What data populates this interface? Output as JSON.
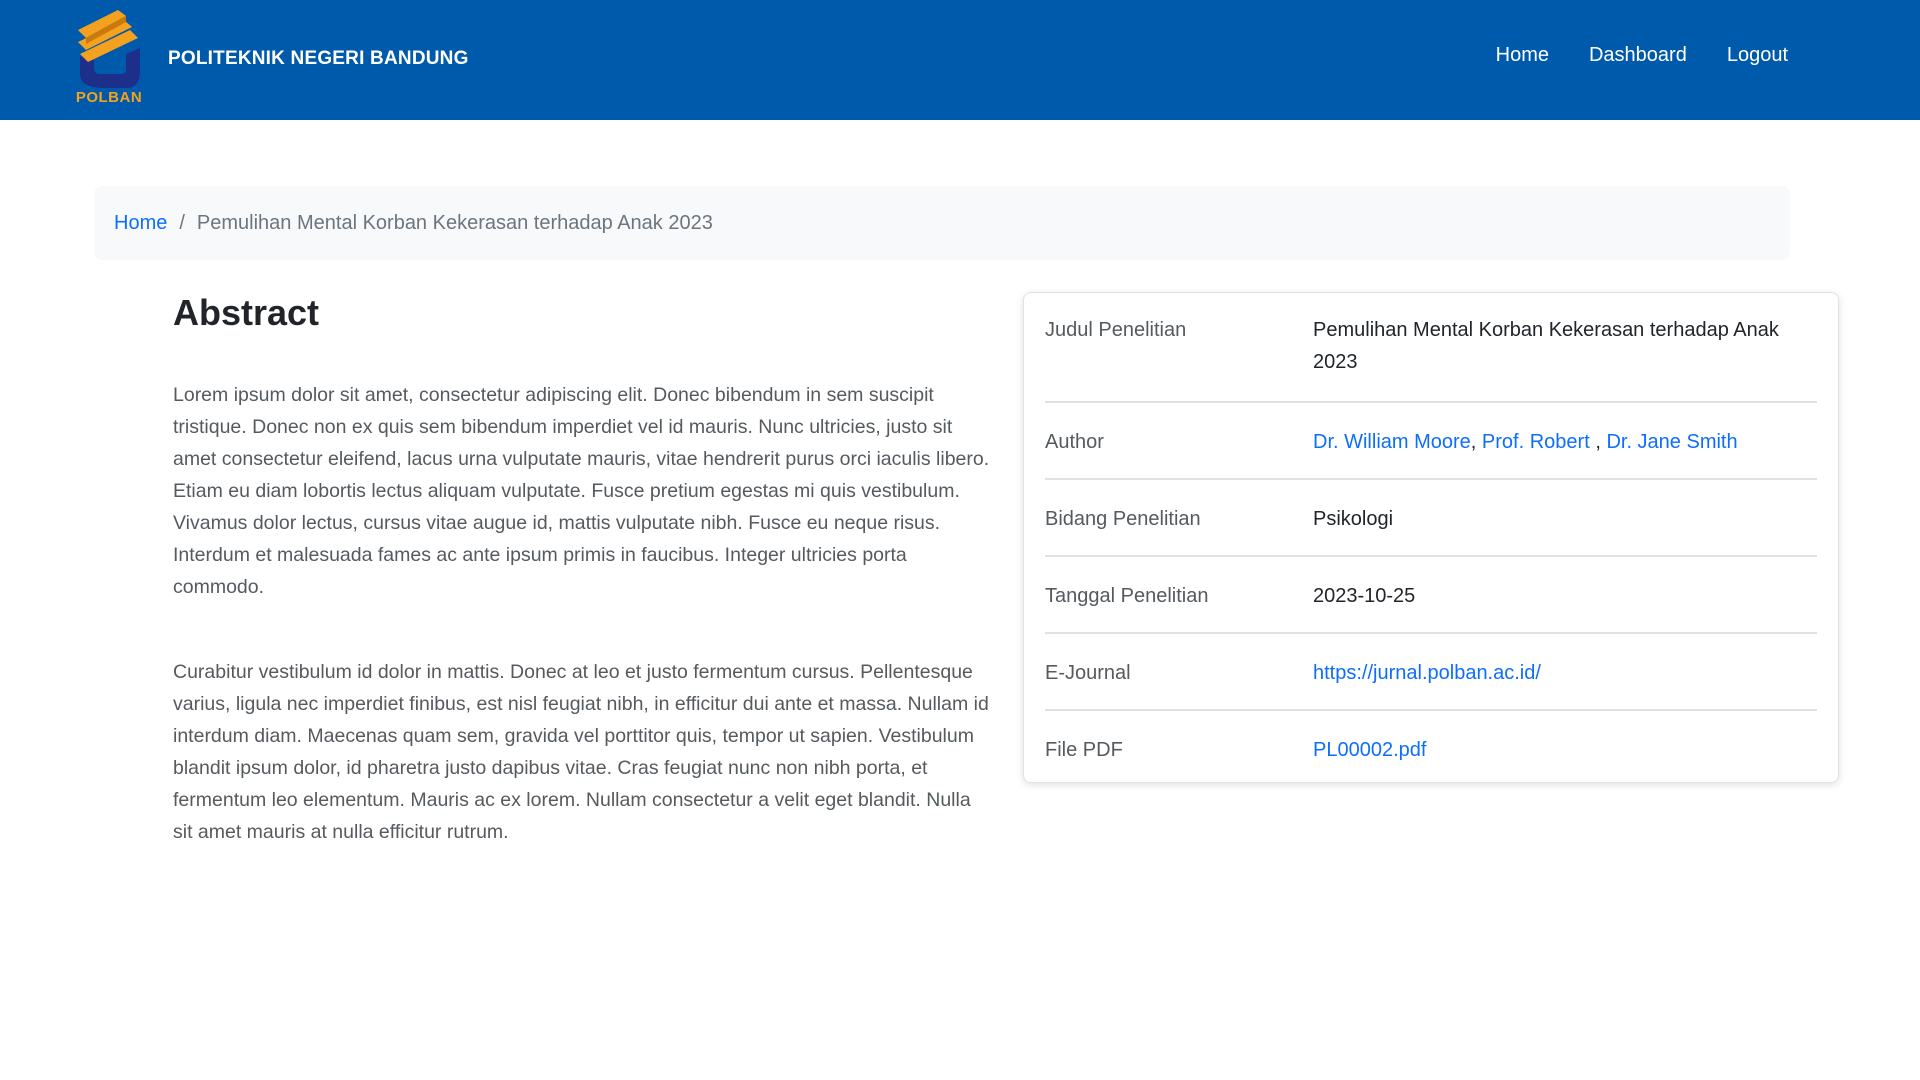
{
  "header": {
    "brand_name": "POLITEKNIK NEGERI BANDUNG",
    "logo_text": "POLBAN",
    "nav": [
      "Home",
      "Dashboard",
      "Logout"
    ]
  },
  "breadcrumb": {
    "home": "Home",
    "separator": "/",
    "current": "Pemulihan Mental Korban Kekerasan terhadap Anak 2023"
  },
  "abstract": {
    "heading": "Abstract",
    "paragraphs": [
      "Lorem ipsum dolor sit amet, consectetur adipiscing elit. Donec bibendum in sem suscipit tristique. Donec non ex quis sem bibendum imperdiet vel id mauris. Nunc ultricies, justo sit amet consectetur eleifend, lacus urna vulputate mauris, vitae hendrerit purus orci iaculis libero. Etiam eu diam lobortis lectus aliquam vulputate. Fusce pretium egestas mi quis vestibulum. Vivamus dolor lectus, cursus vitae augue id, mattis vulputate nibh. Fusce eu neque risus. Interdum et malesuada fames ac ante ipsum primis in faucibus. Integer ultricies porta commodo.",
      "Curabitur vestibulum id dolor in mattis. Donec at leo et justo fermentum cursus. Pellentesque varius, ligula nec imperdiet finibus, est nisl feugiat nibh, in efficitur dui ante et massa. Nullam id interdum diam. Maecenas quam sem, gravida vel porttitor quis, tempor ut sapien. Vestibulum blandit ipsum dolor, id pharetra justo dapibus vitae. Cras feugiat nunc non nibh porta, et fermentum leo elementum. Mauris ac ex lorem. Nullam consectetur a velit eget blandit. Nulla sit amet mauris at nulla efficitur rutrum."
    ]
  },
  "details": {
    "title_label": "Judul Penelitian",
    "title_value": "Pemulihan Mental Korban Kekerasan terhadap Anak 2023",
    "author_label": "Author",
    "authors": [
      "Dr. William Moore",
      "Prof. Robert ",
      "Dr. Jane Smith"
    ],
    "field_label": "Bidang Penelitian",
    "field_value": "Psikologi",
    "date_label": "Tanggal Penelitian",
    "date_value": "2023-10-25",
    "journal_label": "E-Journal",
    "journal_value": "https://jurnal.polban.ac.id/",
    "pdf_label": "File PDF",
    "pdf_value": "PL00002.pdf"
  },
  "colors": {
    "navbar": "#005aab",
    "link": "#0d6efd",
    "logo_orange": "#f4a11f"
  }
}
